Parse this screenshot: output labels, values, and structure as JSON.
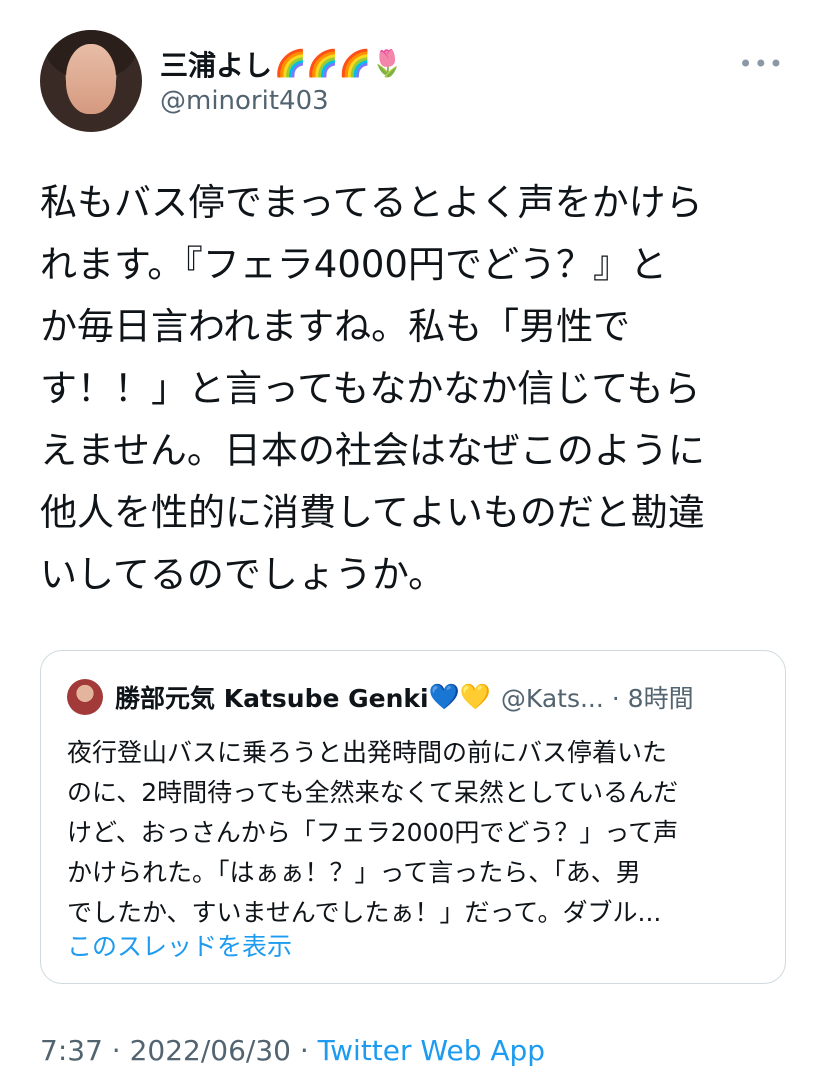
{
  "author": {
    "display_name": "三浦よし",
    "display_emojis": "🌈🌈🌈🌷",
    "handle": "@minorit403"
  },
  "tweet": {
    "text": "私もバス停でまってるとよく声をかけら\nれます。『フェラ4000円でどう？』と\nか毎日言われますね。私も「男性で\nす！！」と言ってもなかなか信じてもら\nえません。日本の社会はなぜこのように\n他人を性的に消費してよいものだと勘違\nいしてるのでしょうか。"
  },
  "quote": {
    "display_name": "勝部元気 Katsube Genki",
    "name_emojis": "💙💛",
    "handle_and_time": "@Kats... · 8時間",
    "text": "夜行登山バスに乗ろうと出発時間の前にバス停着いた\nのに、2時間待っても全然来なくて呆然としているんだ\nけど、おっさんから「フェラ2000円でどう？」って声\nかけられた。「はぁぁ！？」って言ったら、「あ、男\nでしたか、すいませんでしたぁ！」だって。ダブル...",
    "show_thread": "このスレッドを表示"
  },
  "footer": {
    "time_date": "7:37 · 2022/06/30 · ",
    "app": "Twitter Web App"
  },
  "colors": {
    "link": "#1d9bf0",
    "secondary_text": "#536471",
    "border": "#cfd9de"
  }
}
